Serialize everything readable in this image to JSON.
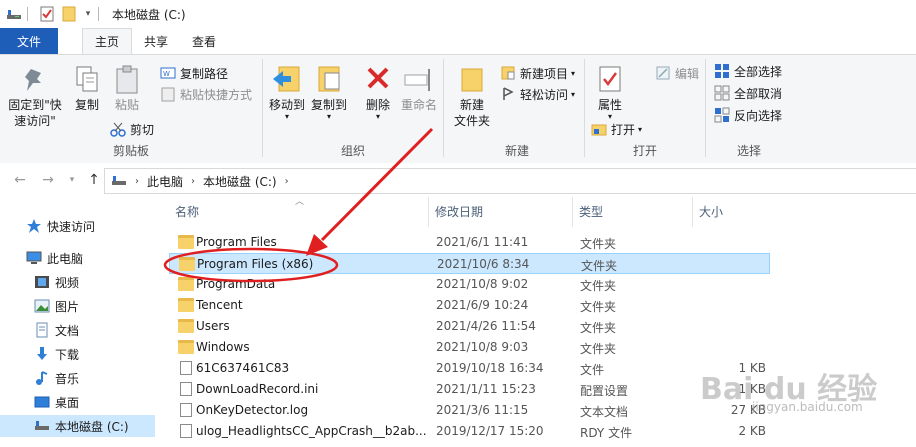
{
  "window": {
    "title": "本地磁盘 (C:)"
  },
  "tabs": [
    {
      "label": "文件"
    },
    {
      "label": "主页"
    },
    {
      "label": "共享"
    },
    {
      "label": "查看"
    }
  ],
  "ribbon": {
    "clipboard": {
      "pin_label": "固定到\"快\n速访问\"",
      "copy_label": "复制",
      "paste_label": "粘贴",
      "copy_path_label": "复制路径",
      "paste_shortcut_label": "粘贴快捷方式",
      "cut_label": "剪切",
      "group_label": "剪贴板"
    },
    "organize": {
      "move_to_label": "移动到",
      "copy_to_label": "复制到",
      "delete_label": "删除",
      "rename_label": "重命名",
      "group_label": "组织"
    },
    "new": {
      "new_folder_label": "新建\n文件夹",
      "new_item_label": "新建项目",
      "easy_access_label": "轻松访问",
      "group_label": "新建"
    },
    "open": {
      "properties_label": "属性",
      "open_label": "打开",
      "edit_label": "编辑",
      "group_label": "打开"
    },
    "select": {
      "select_all_label": "全部选择",
      "select_none_label": "全部取消",
      "invert_label": "反向选择",
      "group_label": "选择"
    }
  },
  "address": {
    "crumbs": [
      "此电脑",
      "本地磁盘 (C:)"
    ]
  },
  "sidebar": {
    "items": [
      {
        "label": "快速访问",
        "icon": "star-icon"
      },
      {
        "label": "此电脑",
        "icon": "computer-icon"
      },
      {
        "label": "视频",
        "icon": "video-icon"
      },
      {
        "label": "图片",
        "icon": "picture-icon"
      },
      {
        "label": "文档",
        "icon": "document-icon"
      },
      {
        "label": "下载",
        "icon": "download-icon"
      },
      {
        "label": "音乐",
        "icon": "music-icon"
      },
      {
        "label": "桌面",
        "icon": "desktop-icon"
      },
      {
        "label": "本地磁盘 (C:)",
        "icon": "drive-icon"
      }
    ]
  },
  "columns": {
    "name": "名称",
    "date": "修改日期",
    "type": "类型",
    "size": "大小"
  },
  "files": [
    {
      "name": "Program Files",
      "date": "2021/6/1 11:41",
      "type": "文件夹",
      "size": "",
      "kind": "folder"
    },
    {
      "name": "Program Files (x86)",
      "date": "2021/10/6 8:34",
      "type": "文件夹",
      "size": "",
      "kind": "folder"
    },
    {
      "name": "ProgramData",
      "date": "2021/10/8 9:02",
      "type": "文件夹",
      "size": "",
      "kind": "folder"
    },
    {
      "name": "Tencent",
      "date": "2021/6/9 10:24",
      "type": "文件夹",
      "size": "",
      "kind": "folder"
    },
    {
      "name": "Users",
      "date": "2021/4/26 11:54",
      "type": "文件夹",
      "size": "",
      "kind": "folder"
    },
    {
      "name": "Windows",
      "date": "2021/10/8 9:03",
      "type": "文件夹",
      "size": "",
      "kind": "folder"
    },
    {
      "name": "61C637461C83",
      "date": "2019/10/18 16:34",
      "type": "文件",
      "size": "1 KB",
      "kind": "file"
    },
    {
      "name": "DownLoadRecord.ini",
      "date": "2021/1/11 15:23",
      "type": "配置设置",
      "size": "1 KB",
      "kind": "file"
    },
    {
      "name": "OnKeyDetector.log",
      "date": "2021/3/6 11:15",
      "type": "文本文档",
      "size": "27 KB",
      "kind": "file"
    },
    {
      "name": "ulog_HeadlightsCC_AppCrash__b2ab...",
      "date": "2019/12/17 15:20",
      "type": "RDY 文件",
      "size": "2 KB",
      "kind": "file"
    }
  ],
  "watermark": {
    "text": "Bai du 经验",
    "url": "jingyan.baidu.com"
  },
  "colors": {
    "accent": "#1f5eb8",
    "selection": "#cce8ff",
    "annotation": "#e02020"
  }
}
